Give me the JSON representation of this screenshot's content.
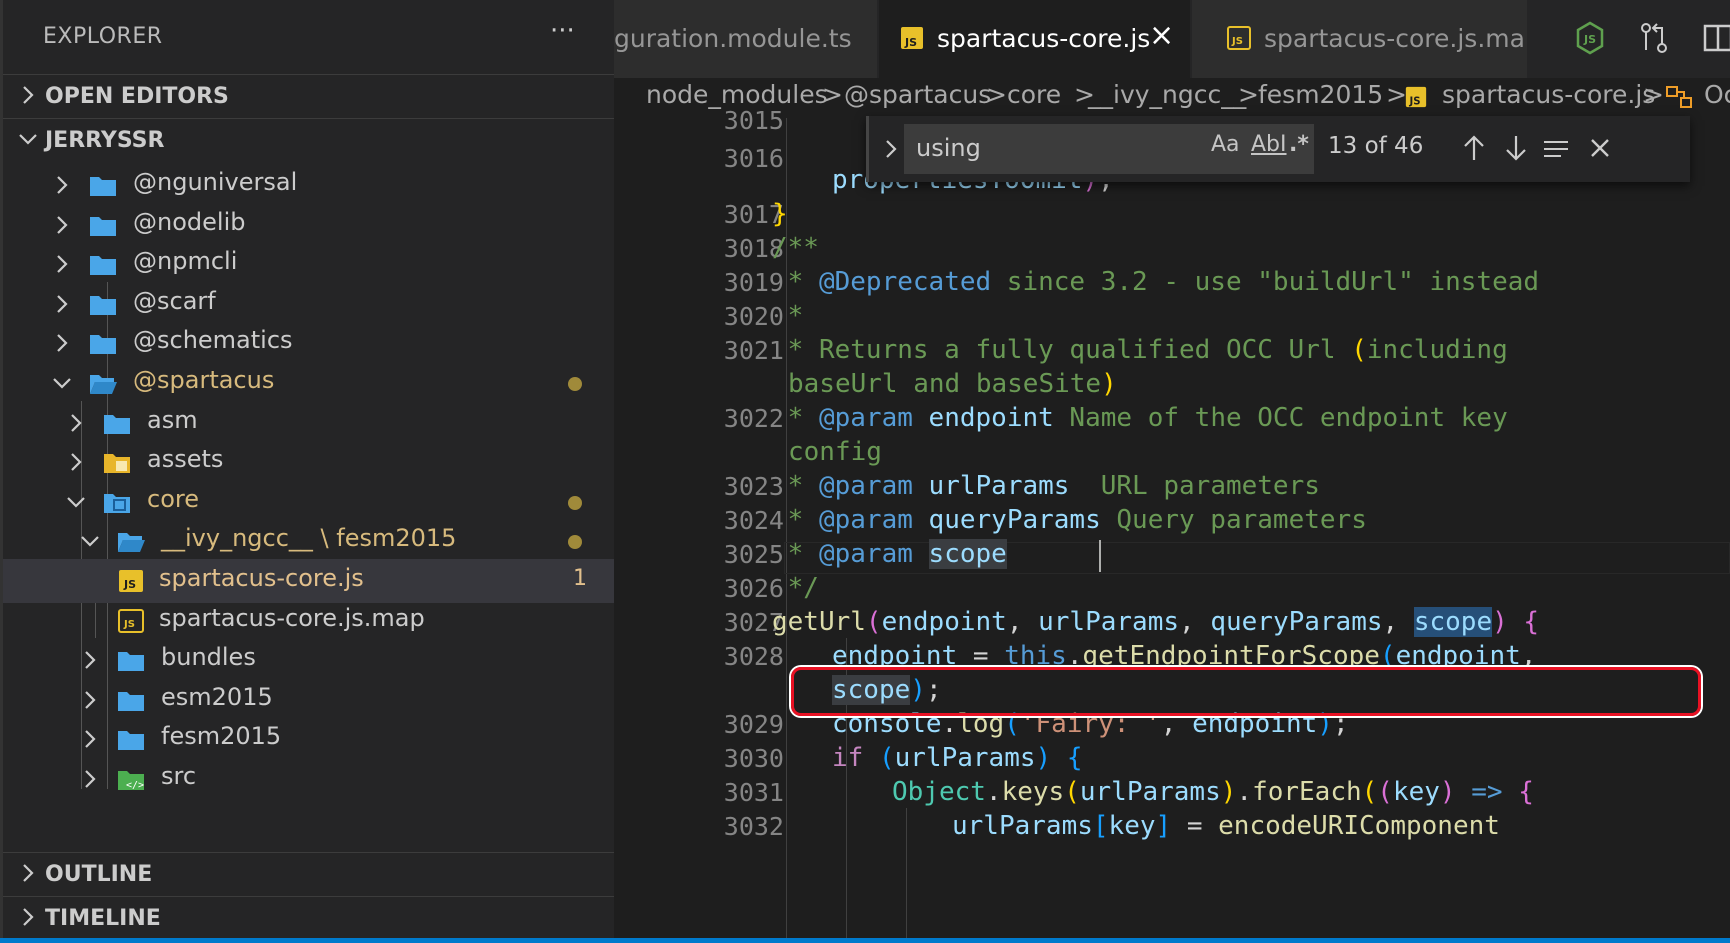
{
  "sidebar": {
    "title": "EXPLORER",
    "more": "···",
    "sections": {
      "open_editors": "OPEN EDITORS",
      "project": "JERRYSSR",
      "outline": "OUTLINE",
      "timeline": "TIMELINE"
    },
    "tree": [
      {
        "label": "@nguniversal",
        "kind": "folder",
        "depth": 0,
        "expanded": false
      },
      {
        "label": "@nodelib",
        "kind": "folder",
        "depth": 0,
        "expanded": false
      },
      {
        "label": "@npmcli",
        "kind": "folder",
        "depth": 0,
        "expanded": false
      },
      {
        "label": "@scarf",
        "kind": "folder",
        "depth": 0,
        "expanded": false
      },
      {
        "label": "@schematics",
        "kind": "folder",
        "depth": 0,
        "expanded": false
      },
      {
        "label": "@spartacus",
        "kind": "folder",
        "depth": 0,
        "expanded": true,
        "modified": true
      },
      {
        "label": "asm",
        "kind": "folder",
        "depth": 1,
        "expanded": false
      },
      {
        "label": "assets",
        "kind": "folder-assets",
        "depth": 1,
        "expanded": false
      },
      {
        "label": "core",
        "kind": "folder-core",
        "depth": 1,
        "expanded": true,
        "modified": true
      },
      {
        "label": "__ivy_ngcc__ \\ fesm2015",
        "kind": "folder",
        "depth": 2,
        "expanded": true,
        "modified": true
      },
      {
        "label": "spartacus-core.js",
        "kind": "js",
        "depth": 3,
        "selected": true,
        "problems": "1"
      },
      {
        "label": "spartacus-core.js.map",
        "kind": "jsmap",
        "depth": 3
      },
      {
        "label": "bundles",
        "kind": "folder",
        "depth": 2,
        "expanded": false
      },
      {
        "label": "esm2015",
        "kind": "folder",
        "depth": 2,
        "expanded": false
      },
      {
        "label": "fesm2015",
        "kind": "folder",
        "depth": 2,
        "expanded": false
      },
      {
        "label": "src",
        "kind": "folder-src",
        "depth": 2,
        "expanded": false
      }
    ]
  },
  "tabs": [
    {
      "label": "guration.module.ts",
      "active": false
    },
    {
      "label": "spartacus-core.js",
      "active": true
    },
    {
      "label": "spartacus-core.js.map",
      "active": false
    }
  ],
  "breadcrumbs": [
    "node_modules",
    "@spartacus",
    "core",
    "__ivy_ngcc__",
    "fesm2015",
    "spartacus-core.js",
    "Oc"
  ],
  "find": {
    "query": "using",
    "match_case": "Aa",
    "whole_word": "AbI",
    "regex": ".*",
    "count": "13 of 46"
  },
  "colors": {
    "accent": "#007acc",
    "highlight_box": "#e81123",
    "modified_dot": "#a08a3a"
  },
  "code": {
    "line_numbers": [
      "3015",
      "3016",
      "3017",
      "3018",
      "3019",
      "3020",
      "3021",
      "3022",
      "3023",
      "3024",
      "3025",
      "3026",
      "3027",
      "3028",
      "3029",
      "3030",
      "3031",
      "3032"
    ],
    "lines": [
      {
        "text": "propertiesToOmit);"
      },
      {
        "text": "}"
      },
      {
        "text": "/**"
      },
      {
        "text": " * @Deprecated since 3.2 - use \"buildUrl\" instead"
      },
      {
        "text": " *"
      },
      {
        "text": " * Returns a fully qualified OCC Url (including"
      },
      {
        "text": "baseUrl and baseSite)"
      },
      {
        "text": " * @param endpoint Name of the OCC endpoint key"
      },
      {
        "text": "config"
      },
      {
        "text": " * @param urlParams  URL parameters"
      },
      {
        "text": " * @param queryParams Query parameters"
      },
      {
        "text": " * @param scope"
      },
      {
        "text": " */"
      },
      {
        "text": "getUrl(endpoint, urlParams, queryParams, scope) {"
      },
      {
        "text": "endpoint = this.getEndpointForScope(endpoint,"
      },
      {
        "text": "scope);"
      },
      {
        "text": "console.log('Fairy: ', endpoint);"
      },
      {
        "text": "if (urlParams) {"
      },
      {
        "text": "Object.keys(urlParams).forEach((key) => {"
      },
      {
        "text": "urlParams[key] = encodeURIComponent"
      }
    ]
  }
}
